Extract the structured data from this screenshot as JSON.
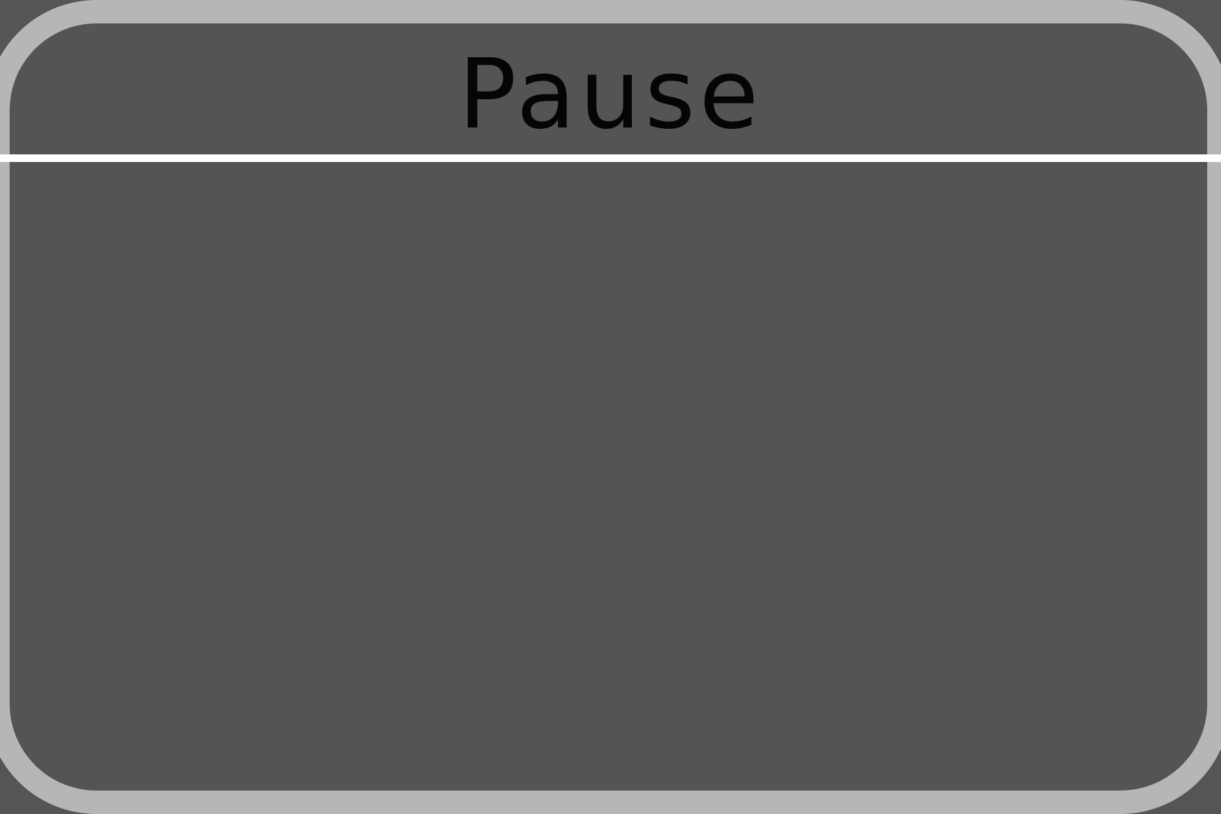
{
  "pause_menu": {
    "title": "Pause"
  },
  "colors": {
    "background": "#555555",
    "panel_fill": "#545454",
    "panel_border": "#b6b6b6",
    "divider": "#ffffff",
    "title_text": "#050505"
  }
}
